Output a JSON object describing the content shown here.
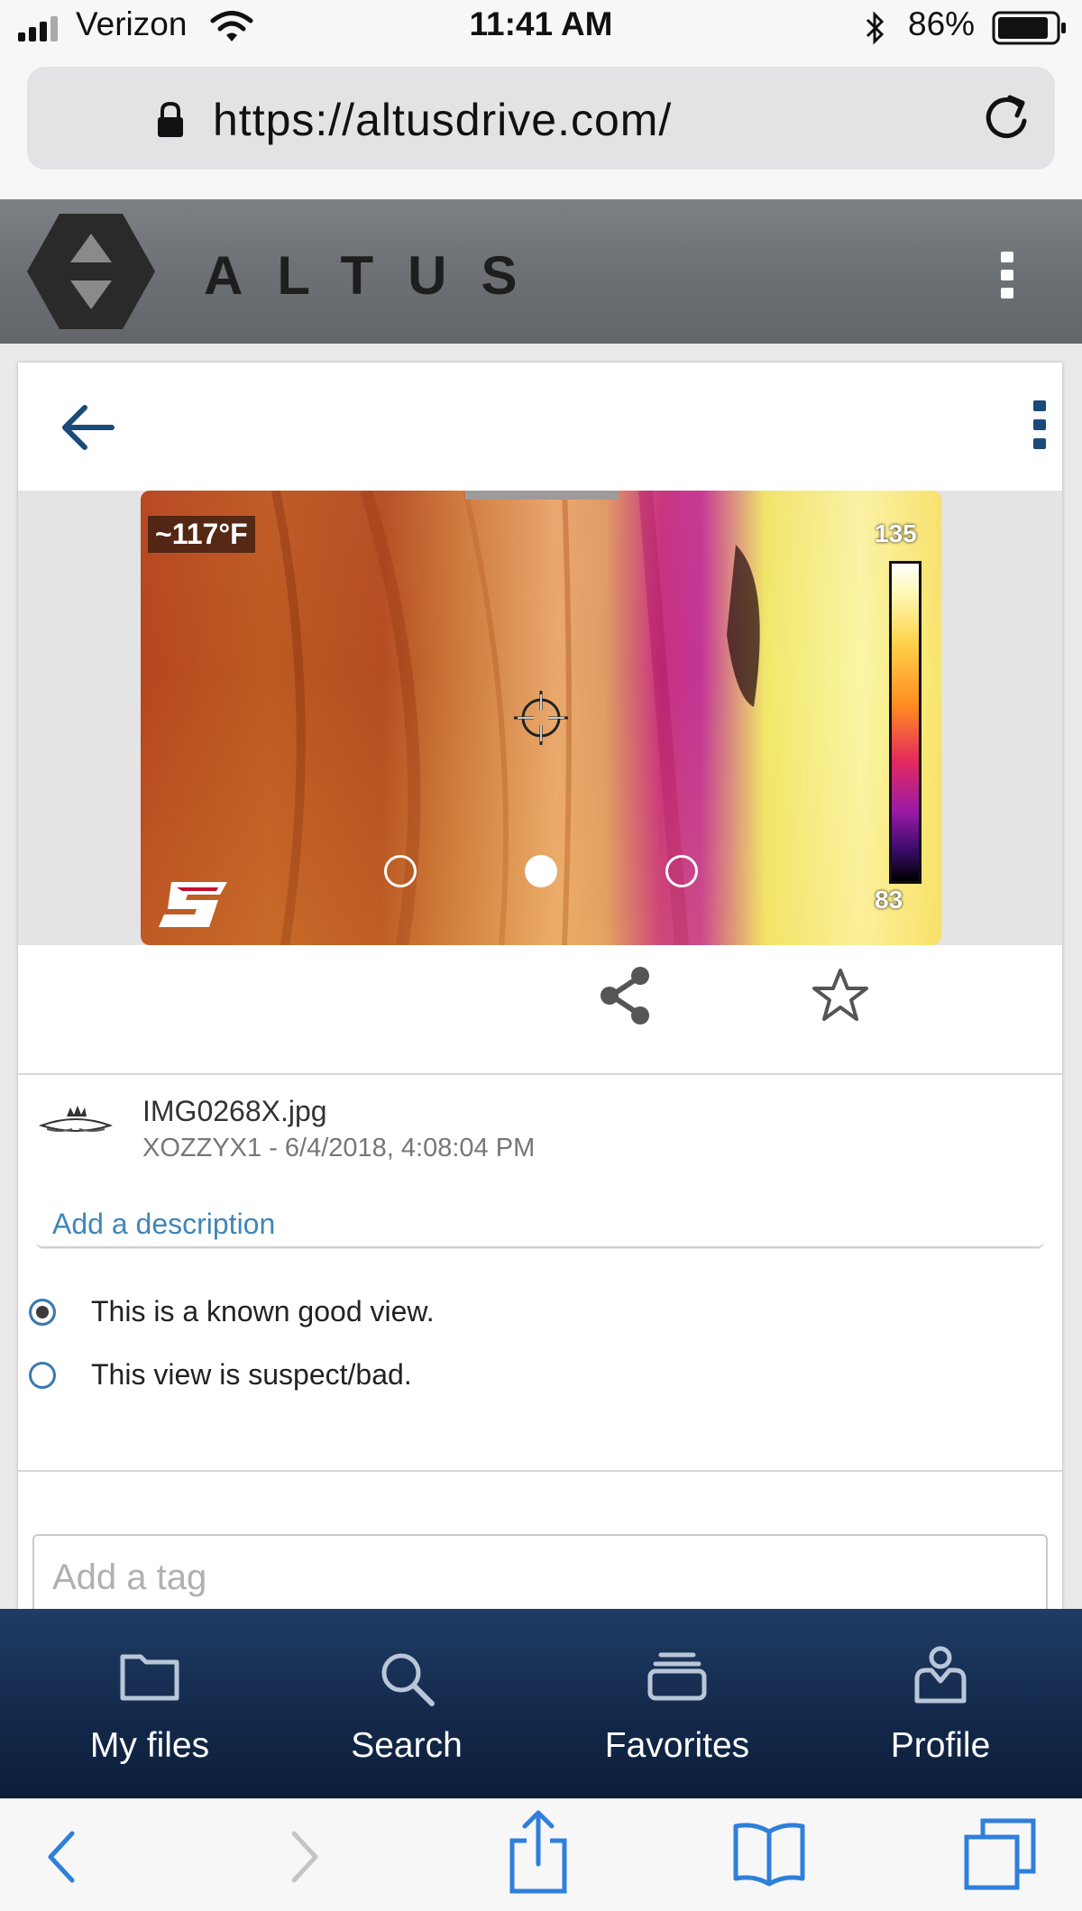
{
  "status_bar": {
    "carrier": "Verizon",
    "time": "11:41 AM",
    "battery": "86%"
  },
  "browser": {
    "url": "https://altusdrive.com/"
  },
  "header": {
    "brand": "ALTUS"
  },
  "viewer": {
    "temperature": "~117°F",
    "scale_max": "135",
    "scale_min": "83",
    "active_slide": 2,
    "slide_count": 3
  },
  "file": {
    "name": "IMG0268X.jpg",
    "meta": "XOZZYX1 - 6/4/2018, 4:08:04 PM",
    "description_placeholder": "Add a description"
  },
  "view_status": {
    "options": [
      "This is a known good view.",
      "This view is suspect/bad."
    ],
    "selected": 0
  },
  "tags": {
    "placeholder": "Add a tag"
  },
  "bottom_nav": {
    "items": [
      "My files",
      "Search",
      "Favorites",
      "Profile"
    ]
  },
  "colors": {
    "header_gray": "#6d7175",
    "nav_navy": "#13284a",
    "link_blue": "#3f86b9",
    "ios_blue": "#2f7fdc"
  }
}
